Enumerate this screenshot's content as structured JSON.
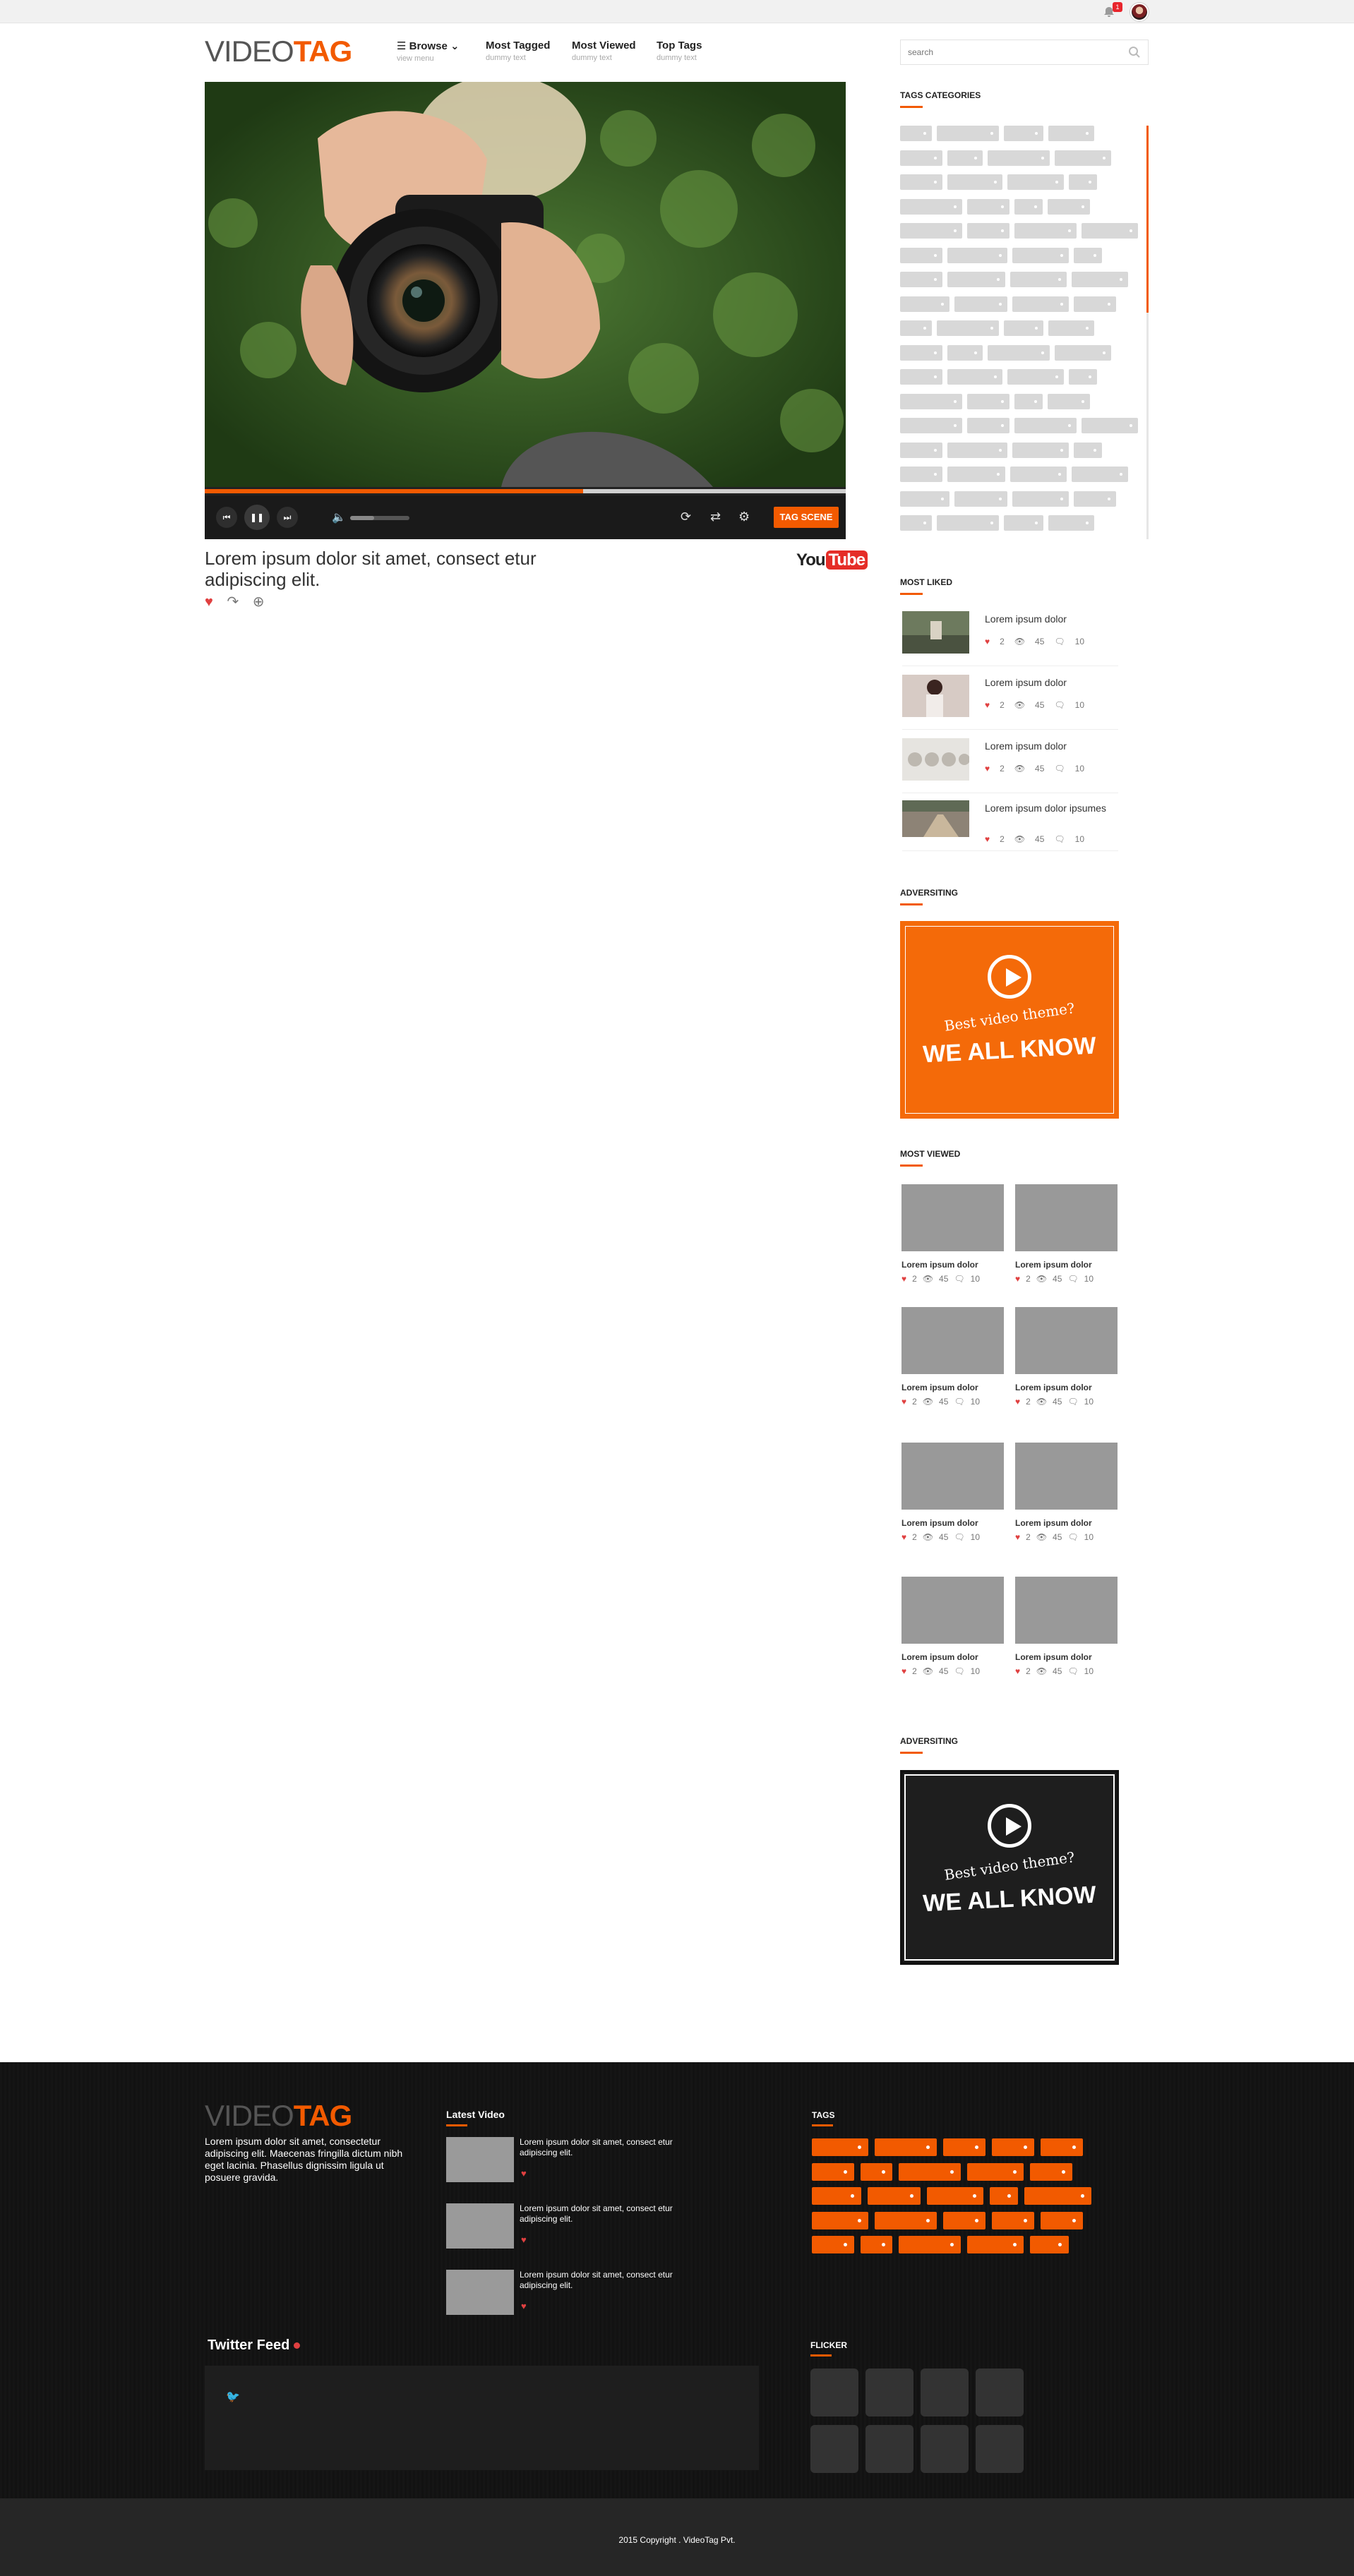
{
  "colors": {
    "accent": "#f25a00",
    "footer_bg": "#141414"
  },
  "topbar": {
    "notification_count": "1",
    "bell_icon": "bell-icon",
    "avatar": "avatar"
  },
  "brand": {
    "part1": "VIDEO",
    "part2": "TAG"
  },
  "nav": [
    {
      "title": "☰ Browse ⌄",
      "sub": "view menu"
    },
    {
      "title": "Most Tagged",
      "sub": "dummy text"
    },
    {
      "title": "Most Viewed",
      "sub": "dummy text"
    },
    {
      "title": "Top Tags",
      "sub": "dummy text"
    }
  ],
  "search": {
    "placeholder": "search",
    "icon": "search-icon"
  },
  "video": {
    "title": "Lorem ipsum dolor sit amet, consect etur adipiscing elit.",
    "progress": 0.59,
    "volume": 0.4,
    "tag_scene_label": "TAG SCENE",
    "source_logo_a": "You",
    "source_logo_b": "Tube"
  },
  "sidebar": {
    "tags_heading": "TAGS CATEGORIES",
    "most_liked_heading": "MOST LIKED",
    "most_liked": [
      {
        "title": "Lorem ipsum dolor",
        "likes": "2",
        "views": "45",
        "comments": "10"
      },
      {
        "title": "Lorem ipsum dolor",
        "likes": "2",
        "views": "45",
        "comments": "10"
      },
      {
        "title": "Lorem ipsum dolor",
        "likes": "2",
        "views": "45",
        "comments": "10"
      },
      {
        "title": "Lorem ipsum dolor ipsumes",
        "likes": "2",
        "views": "45",
        "comments": "10"
      }
    ],
    "ad_heading": "ADVERSITING",
    "ad_line1": "Best video theme?",
    "ad_line2": "WE ALL KNOW",
    "most_viewed_heading": "MOST VIEWED",
    "most_viewed": [
      {
        "title": "Lorem ipsum dolor",
        "likes": "2",
        "views": "45",
        "comments": "10"
      },
      {
        "title": "Lorem ipsum dolor",
        "likes": "2",
        "views": "45",
        "comments": "10"
      },
      {
        "title": "Lorem ipsum dolor",
        "likes": "2",
        "views": "45",
        "comments": "10"
      },
      {
        "title": "Lorem ipsum dolor",
        "likes": "2",
        "views": "45",
        "comments": "10"
      },
      {
        "title": "Lorem ipsum dolor",
        "likes": "2",
        "views": "45",
        "comments": "10"
      },
      {
        "title": "Lorem ipsum dolor",
        "likes": "2",
        "views": "45",
        "comments": "10"
      },
      {
        "title": "Lorem ipsum dolor",
        "likes": "2",
        "views": "45",
        "comments": "10"
      },
      {
        "title": "Lorem ipsum dolor",
        "likes": "2",
        "views": "45",
        "comments": "10"
      }
    ],
    "ad2_heading": "ADVERSITING",
    "ad2_line1": "Best video theme?",
    "ad2_line2": "WE ALL KNOW"
  },
  "footer": {
    "brand_part1": "VIDEO",
    "brand_part2": "TAG",
    "description": "Lorem ipsum dolor sit amet, consectetur adipiscing elit. Maecenas fringilla dictum nibh eget lacinia. Phasellus dignissim ligula ut posuere gravida.",
    "latest_heading": "Latest Video",
    "latest": [
      {
        "text": "Lorem ipsum dolor sit amet, consect etur adipiscing elit."
      },
      {
        "text": "Lorem ipsum dolor sit amet, consect etur adipiscing elit."
      },
      {
        "text": "Lorem ipsum dolor sit amet, consect etur adipiscing elit."
      }
    ],
    "tags_heading": "TAGS",
    "twitter_heading": "Twitter Feed",
    "flicker_heading": "FLICKER",
    "copyright": "2015 Copyright . VideoTag Pvt."
  }
}
